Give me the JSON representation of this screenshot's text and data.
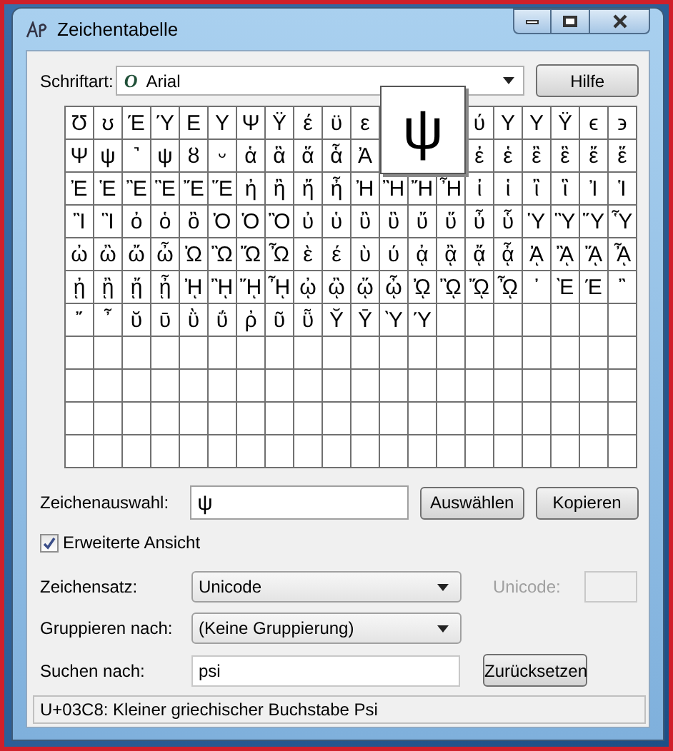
{
  "window": {
    "title": "Zeichentabelle"
  },
  "font": {
    "label": "Schriftart:",
    "type_glyph": "O",
    "value": "Arial"
  },
  "help_button": "Hilfe",
  "grid": {
    "rows": [
      [
        "Ʊ",
        "ʊ",
        "Έ",
        "Ύ",
        "Ε",
        "Υ",
        "Ψ",
        "Ϋ",
        "έ",
        "ϋ",
        "ε",
        null,
        null,
        null,
        "ύ",
        "Υ",
        "Υ",
        "Ϋ",
        "ϵ",
        "϶"
      ],
      [
        "Ψ",
        "ψ",
        "˺",
        "ψ",
        "ȣ",
        "ᵕ",
        "ἁ",
        "ἃ",
        "ἅ",
        "ἇ",
        "Ἀ",
        null,
        null,
        null,
        "ἐ",
        "ἑ",
        "ἒ",
        "ἓ",
        "ἔ",
        "ἕ"
      ],
      [
        "Ἐ",
        "Ἑ",
        "Ἒ",
        "Ἓ",
        "Ἔ",
        "Ἕ",
        "ἠ",
        "ἢ",
        "ἤ",
        "ἦ",
        "Ἠ",
        "Ἢ",
        "Ἤ",
        "Ἦ",
        "ἰ",
        "ἱ",
        "ἲ",
        "ἳ",
        "Ἰ",
        "Ἱ"
      ],
      [
        "Ἲ",
        "Ἳ",
        "ὀ",
        "ὁ",
        "ὂ",
        "Ὀ",
        "Ὁ",
        "Ὂ",
        "ὐ",
        "ὑ",
        "ὒ",
        "ὓ",
        "ὔ",
        "ὕ",
        "ὖ",
        "ὗ",
        "Ὑ",
        "Ὓ",
        "Ὕ",
        "Ὗ"
      ],
      [
        "ὠ",
        "ὢ",
        "ὤ",
        "ὦ",
        "Ὠ",
        "Ὢ",
        "Ὤ",
        "Ὦ",
        "ὲ",
        "έ",
        "ὺ",
        "ύ",
        "ᾀ",
        "ᾂ",
        "ᾄ",
        "ᾆ",
        "ᾈ",
        "ᾊ",
        "ᾌ",
        "ᾎ"
      ],
      [
        "ᾐ",
        "ᾒ",
        "ᾔ",
        "ᾖ",
        "ᾘ",
        "ᾚ",
        "ᾜ",
        "ᾞ",
        "ᾠ",
        "ᾢ",
        "ᾤ",
        "ᾦ",
        "ᾨ",
        "ᾪ",
        "ᾬ",
        "ᾮ",
        "᾽",
        "Ὲ",
        "Έ",
        "῍"
      ],
      [
        "῎",
        "῏",
        "ῠ",
        "ῡ",
        "ῢ",
        "ΰ",
        "ῤ",
        "ῦ",
        "ῧ",
        "Ῠ",
        "Ῡ",
        "Ὺ",
        "Ύ"
      ]
    ],
    "magnified": "ψ"
  },
  "selection": {
    "label": "Zeichenauswahl:",
    "value": "ψ",
    "select_button": "Auswählen",
    "copy_button": "Kopieren"
  },
  "extended_view": {
    "label": "Erweiterte Ansicht",
    "checked": true
  },
  "charset": {
    "label": "Zeichensatz:",
    "value": "Unicode"
  },
  "unicode": {
    "label": "Unicode:",
    "disabled": true
  },
  "group_by": {
    "label": "Gruppieren nach:",
    "value": "(Keine Gruppierung)"
  },
  "search": {
    "label": "Suchen nach:",
    "value": "psi",
    "reset_button": "Zurücksetzen"
  },
  "status_bar": "U+03C8: Kleiner griechischer Buchstabe Psi"
}
